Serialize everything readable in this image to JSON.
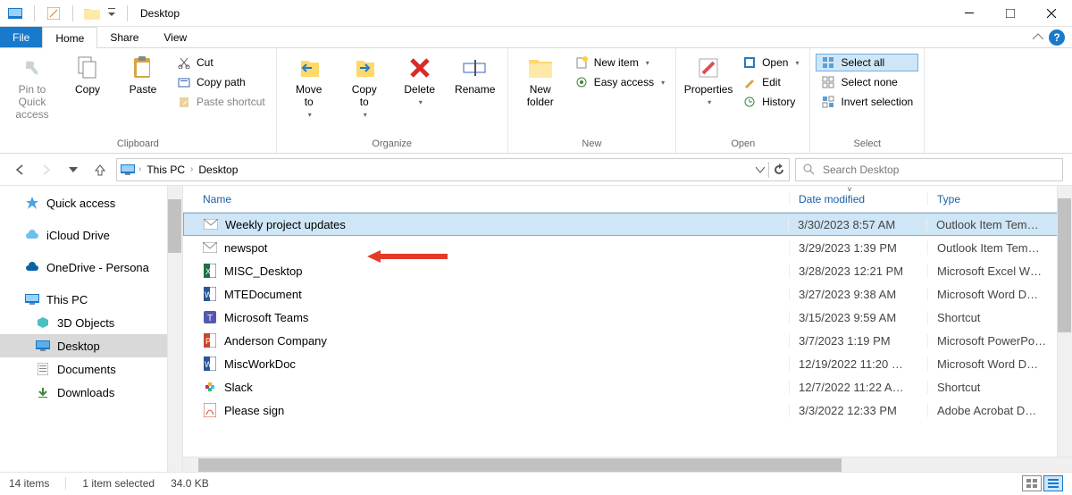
{
  "title": "Desktop",
  "tabs": {
    "file": "File",
    "home": "Home",
    "share": "Share",
    "view": "View"
  },
  "ribbon": {
    "clipboard": {
      "label": "Clipboard",
      "pin": "Pin to Quick\naccess",
      "copy": "Copy",
      "paste": "Paste",
      "cut": "Cut",
      "copypath": "Copy path",
      "pasteshortcut": "Paste shortcut"
    },
    "organize": {
      "label": "Organize",
      "moveto": "Move\nto",
      "copyto": "Copy\nto",
      "delete": "Delete",
      "rename": "Rename"
    },
    "new": {
      "label": "New",
      "newfolder": "New\nfolder",
      "newitem": "New item",
      "easyaccess": "Easy access"
    },
    "open": {
      "label": "Open",
      "properties": "Properties",
      "open": "Open",
      "edit": "Edit",
      "history": "History"
    },
    "select": {
      "label": "Select",
      "selectall": "Select all",
      "selectnone": "Select none",
      "invert": "Invert selection"
    }
  },
  "breadcrumb": [
    "This PC",
    "Desktop"
  ],
  "search_placeholder": "Search Desktop",
  "nav": [
    {
      "label": "Quick access",
      "icon": "star"
    },
    {
      "label": "iCloud Drive",
      "icon": "cloud"
    },
    {
      "label": "OneDrive - Persona",
      "icon": "onedrive"
    },
    {
      "label": "This PC",
      "icon": "pc"
    },
    {
      "label": "3D Objects",
      "icon": "3d",
      "indent": true
    },
    {
      "label": "Desktop",
      "icon": "desktop",
      "indent": true,
      "selected": true
    },
    {
      "label": "Documents",
      "icon": "doc",
      "indent": true
    },
    {
      "label": "Downloads",
      "icon": "down",
      "indent": true
    }
  ],
  "columns": {
    "name": "Name",
    "date": "Date modified",
    "type": "Type"
  },
  "files": [
    {
      "name": "Weekly project updates",
      "date": "3/30/2023 8:57 AM",
      "type": "Outlook Item Tem…",
      "icon": "mail",
      "selected": true
    },
    {
      "name": "newspot",
      "date": "3/29/2023 1:39 PM",
      "type": "Outlook Item Tem…",
      "icon": "mail"
    },
    {
      "name": "MISC_Desktop",
      "date": "3/28/2023 12:21 PM",
      "type": "Microsoft Excel W…",
      "icon": "excel"
    },
    {
      "name": "MTEDocument",
      "date": "3/27/2023 9:38 AM",
      "type": "Microsoft Word D…",
      "icon": "word"
    },
    {
      "name": "Microsoft Teams",
      "date": "3/15/2023 9:59 AM",
      "type": "Shortcut",
      "icon": "teams"
    },
    {
      "name": "Anderson Company",
      "date": "3/7/2023 1:19 PM",
      "type": "Microsoft PowerPo…",
      "icon": "ppt"
    },
    {
      "name": "MiscWorkDoc",
      "date": "12/19/2022 11:20 …",
      "type": "Microsoft Word D…",
      "icon": "word"
    },
    {
      "name": "Slack",
      "date": "12/7/2022 11:22 A…",
      "type": "Shortcut",
      "icon": "slack"
    },
    {
      "name": "Please sign",
      "date": "3/3/2022 12:33 PM",
      "type": "Adobe Acrobat D…",
      "icon": "pdf"
    }
  ],
  "status": {
    "count": "14 items",
    "selected": "1 item selected",
    "size": "34.0 KB"
  }
}
